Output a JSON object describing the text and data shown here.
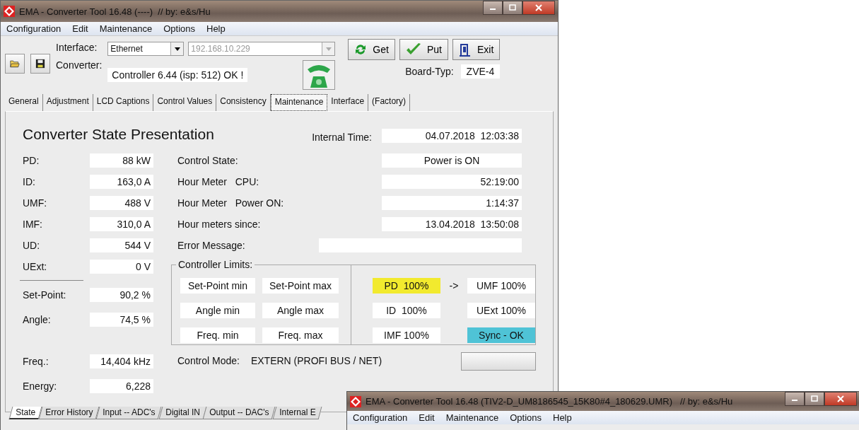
{
  "window": {
    "title": "EMA - Converter Tool 16.48 (----)  // by: e&s/Hu"
  },
  "menu": [
    "Configuration",
    "Edit",
    "Maintenance",
    "Options",
    "Help"
  ],
  "toolbar": {
    "interface_label": "Interface:",
    "interface_value": "Ethernet",
    "address": "192.168.10.229",
    "converter_label": "Converter:",
    "converter_value": "Controller 6.44 (isp: 512) OK !",
    "buttons": [
      {
        "label": "Get",
        "kind": "refresh"
      },
      {
        "label": "Put",
        "kind": "check"
      },
      {
        "label": "Exit",
        "kind": "exit"
      }
    ],
    "board_label": "Board-Typ:",
    "board_value": "ZVE-4"
  },
  "tabs": [
    {
      "label": "General",
      "selected": false
    },
    {
      "label": "Adjustment",
      "selected": false
    },
    {
      "label": "LCD Captions",
      "selected": false
    },
    {
      "label": "Control Values",
      "selected": false
    },
    {
      "label": "Consistency",
      "selected": false
    },
    {
      "label": "Maintenance",
      "selected": true
    },
    {
      "label": "Interface",
      "selected": false
    },
    {
      "label": "(Factory)",
      "selected": false
    }
  ],
  "panel": {
    "title": "Converter State Presentation",
    "internal_time_label": "Internal Time:",
    "internal_time": "04.07.2018  12:03:38",
    "measurements": [
      {
        "label": "PD:",
        "value": "88 kW"
      },
      {
        "label": "ID:",
        "value": "163,0 A"
      },
      {
        "label": "UMF:",
        "value": "488 V"
      },
      {
        "label": "IMF:",
        "value": "310,0 A"
      },
      {
        "label": "UD:",
        "value": "544 V"
      },
      {
        "label": "UExt:",
        "value": "0 V"
      }
    ],
    "status": [
      {
        "label": "Control State:",
        "value": "Power is ON",
        "kind": "centered"
      },
      {
        "label": "Hour Meter   CPU:",
        "value": "52:19:00",
        "kind": "right"
      },
      {
        "label": "Hour Meter   Power ON:",
        "value": "1:14:37",
        "kind": "right"
      },
      {
        "label": "Hour meters since:",
        "value": "13.04.2018  13:50:08",
        "kind": "right"
      },
      {
        "label": "Error Message:",
        "kind": "message"
      }
    ],
    "setpoints": [
      {
        "label": "Set-Point:",
        "value": "90,2 %"
      },
      {
        "label": "Angle:",
        "value": "74,5 %"
      }
    ],
    "limits": {
      "title": "Controller Limits:",
      "buttons": [
        "Set-Point min",
        "Set-Point max",
        "Angle min",
        "Angle max",
        "Freq. min",
        "Freq. max"
      ],
      "indicators": [
        {
          "label": "PD  100%",
          "color": "#f2ea2e"
        },
        {
          "label": "UMF 100%",
          "color": "#ffffff"
        },
        {
          "label": "ID  100%",
          "color": "#ffffff"
        },
        {
          "label": "UExt 100%",
          "color": "#ffffff"
        },
        {
          "label": "IMF 100%",
          "color": "#ffffff"
        },
        {
          "label": "Sync - OK",
          "color": "#4fc3d6"
        }
      ],
      "arrow": "->"
    },
    "frequency": {
      "label": "Freq.:",
      "value": "14,404 kHz"
    },
    "energy": {
      "label": "Energy:",
      "value": "6,228"
    },
    "control_mode": {
      "label": "Control Mode:",
      "value": "EXTERN (PROFI BUS / NET)"
    }
  },
  "bottom_tabs": [
    {
      "label": "State",
      "selected": true
    },
    {
      "label": "Error History",
      "selected": false
    },
    {
      "label": "Input -- ADC's",
      "selected": false
    },
    {
      "label": "Digital  IN",
      "selected": false
    },
    {
      "label": "Output -- DAC's",
      "selected": false
    },
    {
      "label": "Internal E",
      "selected": false
    }
  ],
  "second_window": {
    "title": "EMA - Converter Tool 16.48 (TIV2-D_UM8186545_15K80#4_180629.UMR)   // by: e&s/Hu",
    "menu": [
      "Configuration",
      "Edit",
      "Maintenance",
      "Options",
      "Help"
    ]
  }
}
